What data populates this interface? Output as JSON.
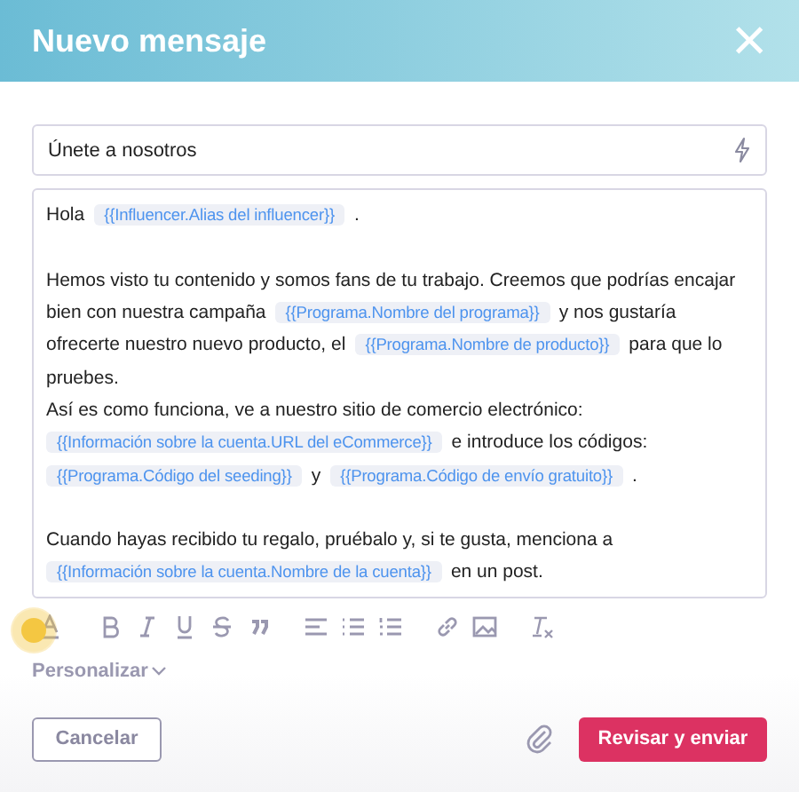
{
  "header": {
    "title": "Nuevo mensaje",
    "close": "×"
  },
  "subject": {
    "value": "Únete a nosotros"
  },
  "body": [
    {
      "lines": [
        [
          {
            "kind": "text",
            "text": "Hola"
          },
          {
            "kind": "tag",
            "text": "{{Influencer.Alias del influencer}}"
          },
          {
            "kind": "text",
            "text": "."
          }
        ]
      ]
    },
    {
      "lines": [
        [
          {
            "kind": "text",
            "text": "Hemos visto tu contenido y somos fans de tu trabajo. Creemos que podrías encajar"
          }
        ],
        [
          {
            "kind": "text",
            "text": "bien con nuestra campaña"
          },
          {
            "kind": "tag",
            "text": "{{Programa.Nombre del programa}}"
          },
          {
            "kind": "text",
            "text": "y nos gustaría"
          }
        ],
        [
          {
            "kind": "text",
            "text": "ofrecerte nuestro nuevo producto, el"
          },
          {
            "kind": "tag",
            "text": "{{Programa.Nombre de producto}}"
          },
          {
            "kind": "text",
            "text": "para que lo"
          }
        ],
        [
          {
            "kind": "text",
            "text": "pruebes."
          }
        ],
        [
          {
            "kind": "text",
            "text": "Así es como funciona, ve a nuestro sitio de comercio electrónico:"
          }
        ],
        [
          {
            "kind": "tag",
            "text": "{{Información sobre la cuenta.URL del eCommerce}}"
          },
          {
            "kind": "text",
            "text": "e introduce los códigos:"
          }
        ],
        [
          {
            "kind": "tag",
            "text": "{{Programa.Código del seeding}}"
          },
          {
            "kind": "text",
            "text": "y"
          },
          {
            "kind": "tag",
            "text": "{{Programa.Código de envío gratuito}}"
          },
          {
            "kind": "text",
            "text": "."
          }
        ]
      ]
    },
    {
      "lines": [
        [
          {
            "kind": "text",
            "text": "Cuando hayas recibido tu regalo, pruébalo y, si te gusta, menciona a"
          }
        ],
        [
          {
            "kind": "tag",
            "text": "{{Información sobre la cuenta.Nombre de la cuenta}}"
          },
          {
            "kind": "text",
            "text": "en un post."
          }
        ]
      ]
    }
  ],
  "toolbar": [
    {
      "kind": "color"
    },
    {
      "kind": "bold"
    },
    {
      "kind": "italic"
    },
    {
      "kind": "underline"
    },
    {
      "kind": "strike"
    },
    {
      "kind": "quote"
    },
    {
      "kind": "align"
    },
    {
      "kind": "bullets"
    },
    {
      "kind": "numbers"
    },
    {
      "kind": "link"
    },
    {
      "kind": "image"
    },
    {
      "kind": "clear"
    }
  ],
  "personalize": "Personalizar",
  "buttons": {
    "cancel": "Cancelar",
    "submit": "Revisar y enviar"
  }
}
